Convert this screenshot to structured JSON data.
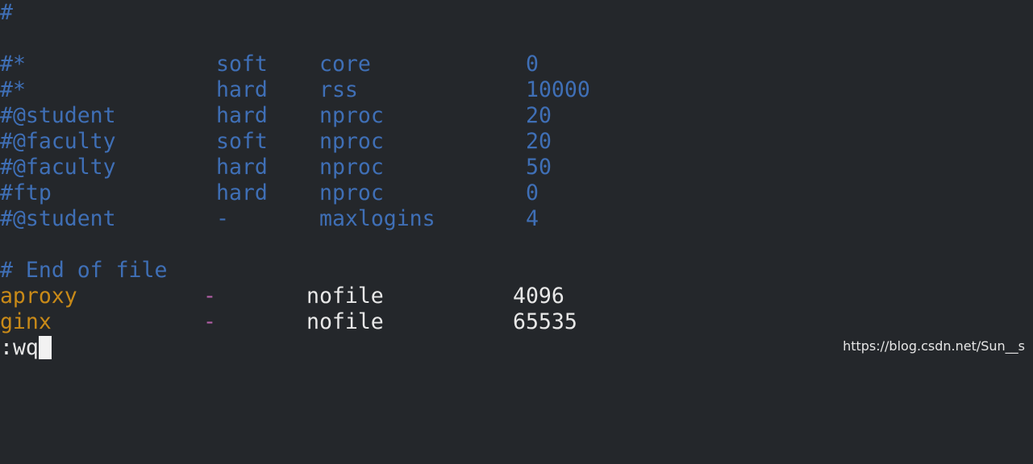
{
  "colors": {
    "background": "#24272b",
    "comment": "#3f6fb6",
    "user": "#c98a18",
    "dash": "#b25fa6",
    "text": "#e8e8e8"
  },
  "editor": {
    "top_comment": "#",
    "commented_rows": [
      {
        "domain": "#*",
        "type": "soft",
        "item": "core",
        "value": "0"
      },
      {
        "domain": "#*",
        "type": "hard",
        "item": "rss",
        "value": "10000"
      },
      {
        "domain": "#@student",
        "type": "hard",
        "item": "nproc",
        "value": "20"
      },
      {
        "domain": "#@faculty",
        "type": "soft",
        "item": "nproc",
        "value": "20"
      },
      {
        "domain": "#@faculty",
        "type": "hard",
        "item": "nproc",
        "value": "50"
      },
      {
        "domain": "#ftp",
        "type": "hard",
        "item": "nproc",
        "value": "0"
      },
      {
        "domain": "#@student",
        "type": "-",
        "item": "maxlogins",
        "value": "4"
      }
    ],
    "end_comment": "# End of file",
    "active_rows": [
      {
        "domain": "haproxy",
        "type": "-",
        "item": "nofile",
        "value": "4096"
      },
      {
        "domain": "nginx",
        "type": "-",
        "item": "nofile",
        "value": "65535"
      }
    ]
  },
  "command_line": {
    "text": ":wq"
  },
  "watermark": "https://blog.csdn.net/Sun__s"
}
